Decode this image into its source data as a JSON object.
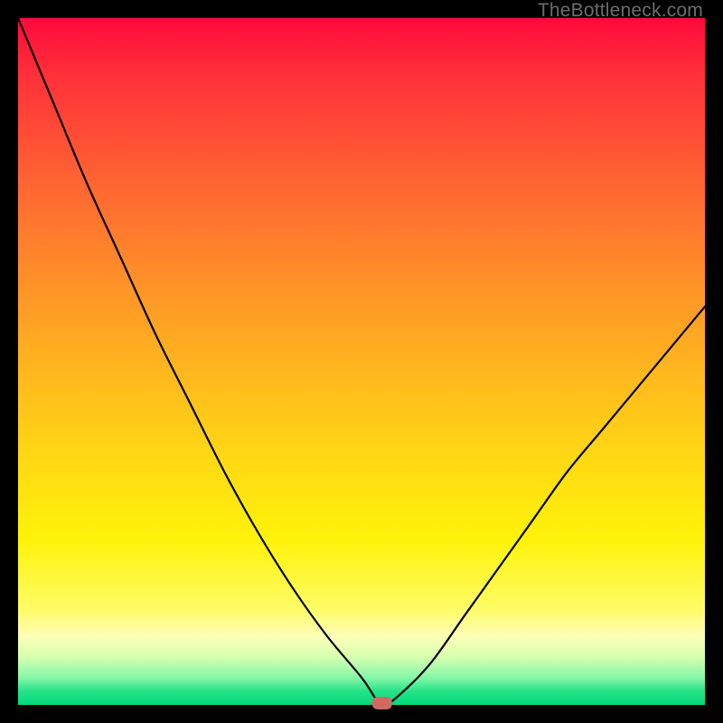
{
  "watermark": "TheBottleneck.com",
  "colors": {
    "frame": "#000000",
    "gradient_top": "#ff0a3c",
    "gradient_bottom": "#00d977",
    "curve": "#000000",
    "marker": "#cf6a5f"
  },
  "chart_data": {
    "type": "line",
    "title": "",
    "xlabel": "",
    "ylabel": "",
    "xlim": [
      0,
      100
    ],
    "ylim": [
      0,
      100
    ],
    "grid": false,
    "legend": false,
    "x": [
      0,
      5,
      10,
      15,
      20,
      25,
      30,
      35,
      40,
      45,
      50,
      52,
      53,
      55,
      60,
      65,
      70,
      75,
      80,
      85,
      90,
      95,
      100
    ],
    "values": [
      100,
      88,
      76,
      65,
      54,
      44,
      34,
      25,
      17,
      10,
      4,
      1,
      0,
      1,
      6,
      13,
      20,
      27,
      34,
      40,
      46,
      52,
      58
    ],
    "marker": {
      "x": 53,
      "y": 0,
      "shape": "rounded-rect"
    },
    "annotations": []
  }
}
